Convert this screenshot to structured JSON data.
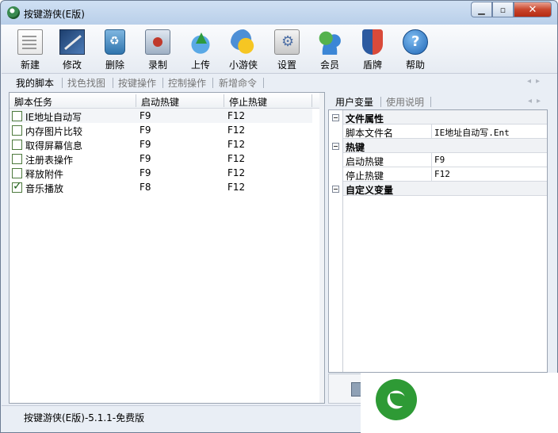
{
  "window": {
    "title": "按键游侠(E版)"
  },
  "toolbar": {
    "items": [
      {
        "label": "新建",
        "icon": "new-file-icon"
      },
      {
        "label": "修改",
        "icon": "edit-icon"
      },
      {
        "label": "删除",
        "icon": "recycle-bin-icon"
      },
      {
        "label": "录制",
        "icon": "record-icon"
      },
      {
        "label": "上传",
        "icon": "upload-icon"
      },
      {
        "label": "小游侠",
        "icon": "mascot-icon"
      },
      {
        "label": "设置",
        "icon": "settings-icon"
      },
      {
        "label": "会员",
        "icon": "members-icon"
      },
      {
        "label": "盾牌",
        "icon": "shield-icon"
      },
      {
        "label": "帮助",
        "icon": "help-icon"
      }
    ]
  },
  "main_tabs": [
    "我的脚本",
    "找色找图",
    "按键操作",
    "控制操作",
    "新增命令"
  ],
  "script_list": {
    "columns": [
      "脚本任务",
      "启动热键",
      "停止热键"
    ],
    "rows": [
      {
        "name": "IE地址自动写",
        "start": "F9",
        "stop": "F12",
        "checked": false
      },
      {
        "name": "内存图片比较",
        "start": "F9",
        "stop": "F12",
        "checked": false
      },
      {
        "name": "取得屏幕信息",
        "start": "F9",
        "stop": "F12",
        "checked": false
      },
      {
        "name": "注册表操作",
        "start": "F9",
        "stop": "F12",
        "checked": false
      },
      {
        "name": "释放附件",
        "start": "F9",
        "stop": "F12",
        "checked": false
      },
      {
        "name": "音乐播放",
        "start": "F8",
        "stop": "F12",
        "checked": true
      }
    ]
  },
  "side_tabs": [
    "用户变量",
    "使用说明"
  ],
  "properties": {
    "file_category": "文件属性",
    "file_name_label": "脚本文件名",
    "file_name_value": "IE地址自动写.Ent",
    "hotkey_category": "热键",
    "start_label": "启动热键",
    "start_value": "F9",
    "stop_label": "停止热键",
    "stop_value": "F12",
    "custom_category": "自定义变量"
  },
  "status": {
    "text": "按键游侠(E版)-5.1.1-免费版"
  }
}
